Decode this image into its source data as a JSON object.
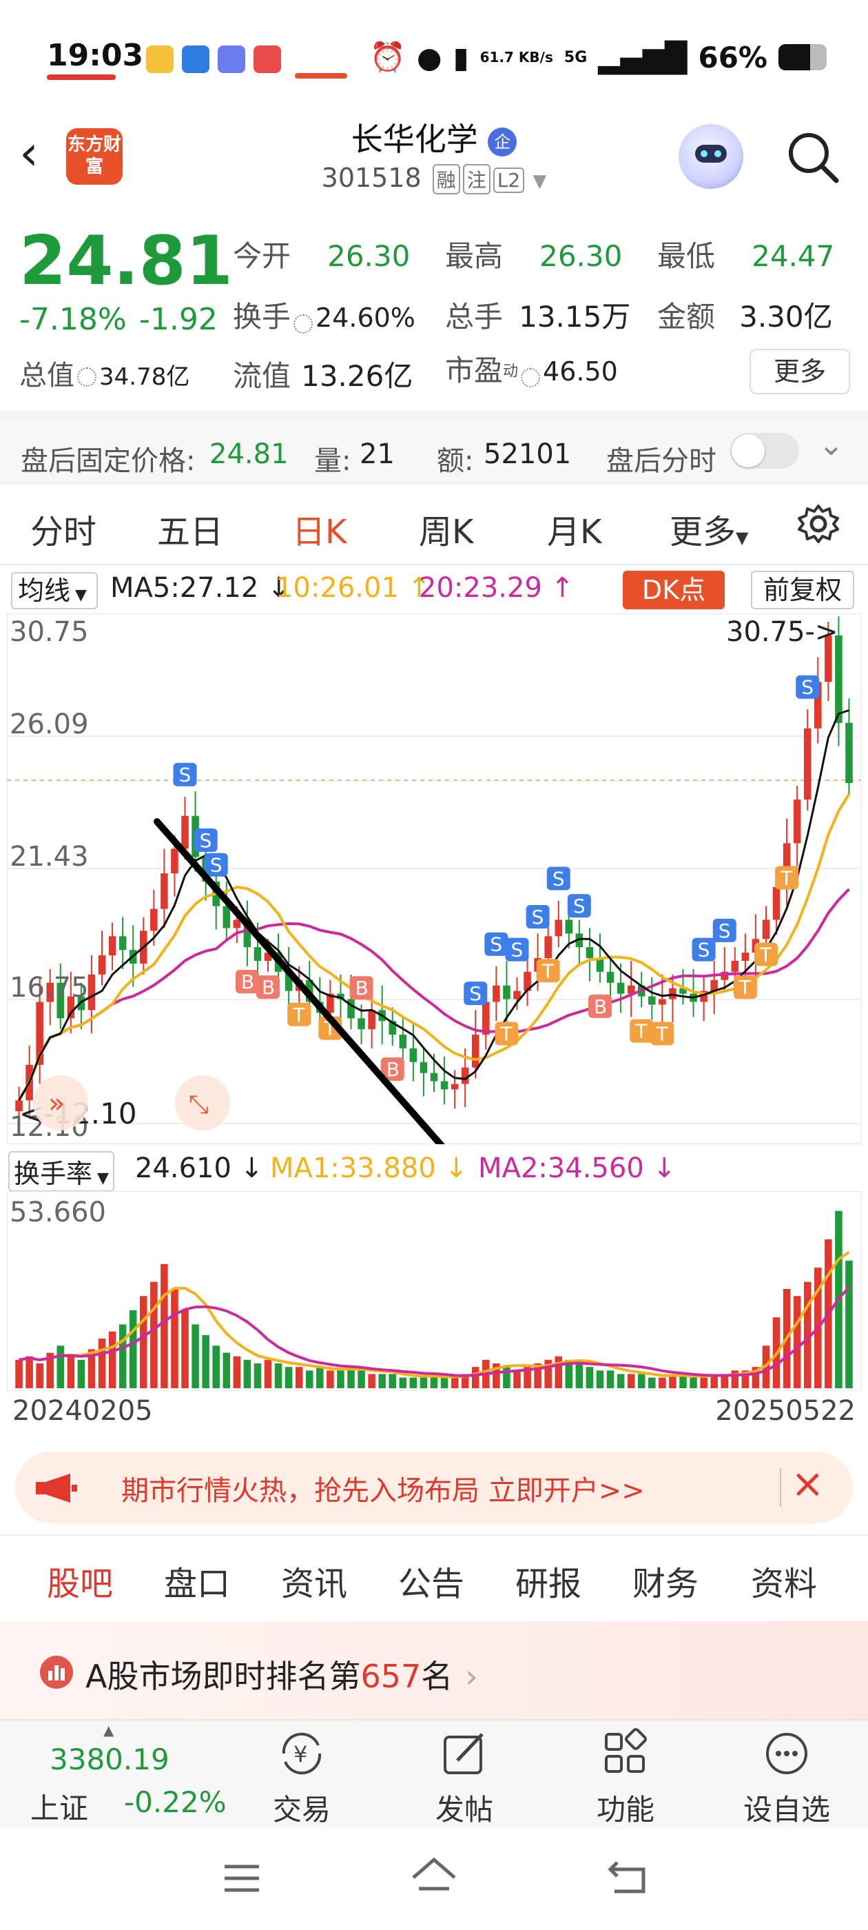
{
  "status_bar": {
    "time": "19:03",
    "network_speed": "61.7 KB/s",
    "network_type": "5G",
    "battery": "66%"
  },
  "header": {
    "logo_text": "东方财富",
    "stock_name": "长华化学",
    "stock_badge": "企",
    "stock_code": "301518",
    "tags": [
      "融",
      "注",
      "L2"
    ]
  },
  "quote": {
    "price": "24.81",
    "change_pct": "-7.18%",
    "change_amt": "-1.92",
    "open_label": "今开",
    "open": "26.30",
    "high_label": "最高",
    "high": "26.30",
    "low_label": "最低",
    "low": "24.47",
    "turnover_label": "换手",
    "turnover": "24.60%",
    "volume_label": "总手",
    "volume": "13.15万",
    "amount_label": "金额",
    "amount": "3.30亿",
    "total_mv_label": "总值",
    "total_mv": "34.78亿",
    "float_mv_label": "流值",
    "float_mv": "13.26亿",
    "pe_label": "市盈",
    "pe_sup": "动",
    "pe": "46.50",
    "more_label": "更多"
  },
  "after_hours": {
    "price_label": "盘后固定价格:",
    "price": "24.81",
    "vol_label": "量:",
    "vol": "21",
    "amt_label": "额:",
    "amt": "52101",
    "timeshare_label": "盘后分时"
  },
  "kline_tabs": [
    "分时",
    "五日",
    "日K",
    "周K",
    "月K",
    "更多"
  ],
  "indicators": {
    "ma_select": "均线",
    "ma5": "MA5:27.12",
    "ma10": "10:26.01",
    "ma20": "20:23.29",
    "dk_button": "DK点",
    "restore": "前复权"
  },
  "kline_axis": {
    "top": "30.75",
    "y1": "26.09",
    "y2": "21.43",
    "y3": "16.75",
    "bottom": "12.10",
    "max_marker": "30.75->",
    "min_marker": "<-12.10"
  },
  "turnover": {
    "select": "换手率",
    "value": "24.610",
    "ma1": "MA1:33.880",
    "ma2": "MA2:34.560",
    "axis_top": "53.660"
  },
  "dates": {
    "start": "20240205",
    "end": "20250522"
  },
  "promo": {
    "text": "期市行情火热，抢先入场布局 立即开户>>"
  },
  "sub_tabs": [
    "股吧",
    "盘口",
    "资讯",
    "公告",
    "研报",
    "财务",
    "资料"
  ],
  "rank": {
    "prefix": "A股市场即时排名第",
    "number": "657",
    "suffix": "名"
  },
  "bottom_nav": {
    "index_value": "3380.19",
    "index_name": "上证",
    "index_change": "-0.22%",
    "items": [
      "交易",
      "发帖",
      "功能",
      "设自选"
    ]
  },
  "colors": {
    "down": "#1f9a3a",
    "up": "#e0382d",
    "accent": "#e8502a",
    "ma5": "#111111",
    "ma10": "#f2b21a",
    "ma20": "#cc2a9c"
  },
  "chart_data": {
    "type": "candlestick",
    "ylim": [
      12.1,
      30.75
    ],
    "close_series": [
      13.2,
      14.5,
      16.8,
      17.5,
      16.2,
      17.0,
      16.5,
      17.8,
      18.5,
      19.2,
      18.7,
      18.2,
      19.4,
      20.2,
      21.5,
      22.4,
      23.6,
      22.1,
      21.2,
      20.3,
      19.5,
      19.8,
      18.8,
      18.3,
      18.6,
      17.9,
      17.2,
      17.6,
      16.8,
      16.4,
      17.1,
      16.9,
      16.2,
      15.8,
      16.5,
      16.1,
      15.6,
      15.1,
      14.6,
      14.2,
      13.9,
      13.6,
      13.8,
      14.4,
      15.6,
      16.8,
      17.4,
      16.9,
      17.2,
      17.9,
      18.4,
      19.2,
      19.8,
      19.3,
      18.8,
      18.4,
      17.9,
      17.5,
      17.1,
      17.4,
      17.0,
      16.7,
      16.9,
      17.3,
      17.1,
      16.8,
      17.2,
      17.6,
      17.9,
      18.3,
      18.6,
      19.1,
      19.8,
      21.0,
      22.6,
      24.2,
      26.8,
      28.5,
      30.2,
      27.0,
      24.8
    ],
    "turnover_series": [
      8,
      9,
      7,
      10,
      12,
      9,
      8,
      11,
      14,
      16,
      18,
      22,
      26,
      30,
      35,
      28,
      22,
      18,
      15,
      12,
      10,
      9,
      8,
      7,
      8,
      7,
      6,
      6,
      5,
      6,
      5,
      5,
      6,
      5,
      4,
      4,
      4,
      3,
      3,
      3,
      4,
      3,
      3,
      4,
      6,
      8,
      7,
      6,
      5,
      6,
      7,
      8,
      9,
      8,
      7,
      6,
      5,
      5,
      4,
      4,
      4,
      3,
      3,
      4,
      4,
      3,
      3,
      4,
      4,
      5,
      5,
      6,
      12,
      20,
      28,
      26,
      30,
      34,
      42,
      50,
      36
    ]
  }
}
